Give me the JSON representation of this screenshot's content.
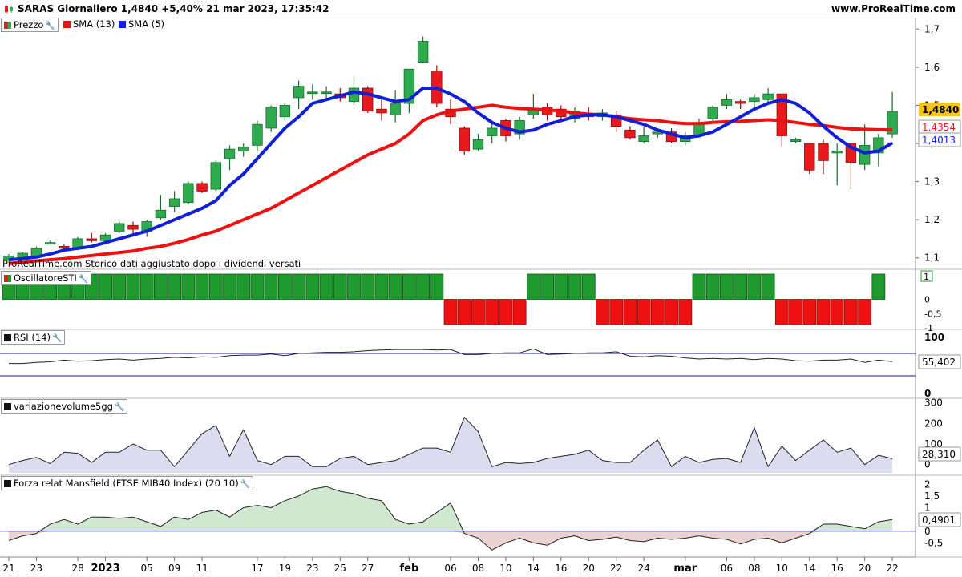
{
  "header": {
    "title": "SARAS Giornaliero 1,4840 +5,40% 21 mar 2023, 17:35:42",
    "site": "www.ProRealTime.com"
  },
  "legend_price": {
    "price": "Prezzo",
    "sma13": "SMA (13)",
    "sma5": "SMA (5)"
  },
  "note": "ProRealTime.com Storico dati aggiustato dopo i dividendi versati",
  "panel_labels": {
    "sti": "OscillatoreSTI",
    "rsi": "RSI (14)",
    "vol": "variazionevolume5gg",
    "mans": "Forza relat Mansfield (FTSE MIB40 Index) (20 10)"
  },
  "colors": {
    "up": "#2eaa4f",
    "down": "#e8191c",
    "sma13": "#ee1111",
    "sma5": "#1020d8",
    "oscGreen": "#1e9a2e",
    "oscRed": "#ee1111",
    "ref": "#1a1a8a",
    "volFill": "#dcdcf0",
    "mansUp": "#cfe8cf",
    "mansDown": "#ecd3d3"
  },
  "chart_data": [
    {
      "type": "candlestick",
      "name": "price",
      "ylim": [
        1.07,
        1.73
      ],
      "yticks": [
        "1,7",
        "1,6",
        "1,5",
        "1,4",
        "1,3",
        "1,2",
        "1,1"
      ],
      "ytick_values": [
        1.7,
        1.6,
        1.5,
        1.4,
        1.3,
        1.2,
        1.1
      ],
      "xticks": [
        "21",
        "23",
        "28",
        "2023",
        "05",
        "09",
        "11",
        "17",
        "19",
        "23",
        "25",
        "27",
        "feb",
        "06",
        "08",
        "10",
        "14",
        "16",
        "20",
        "22",
        "24",
        "mar",
        "06",
        "08",
        "10",
        "14",
        "16",
        "20",
        "22"
      ],
      "xtick_index": [
        0,
        2,
        5,
        7,
        10,
        12,
        14,
        18,
        20,
        22,
        24,
        26,
        29,
        32,
        34,
        36,
        38,
        40,
        42,
        44,
        46,
        49,
        52,
        54,
        56,
        58,
        60,
        62,
        64
      ],
      "last_labels": {
        "price": "1,4840",
        "sma13": "1,4354",
        "sma5": "1,4013"
      },
      "last_values": {
        "price": 1.484,
        "sma13": 1.4354,
        "sma5": 1.4013
      },
      "candles": [
        [
          1.095,
          1.105,
          1.11,
          1.09
        ],
        [
          1.098,
          1.112,
          1.115,
          1.095
        ],
        [
          1.105,
          1.125,
          1.13,
          1.1
        ],
        [
          1.14,
          1.14,
          1.145,
          1.135
        ],
        [
          1.13,
          1.125,
          1.135,
          1.115
        ],
        [
          1.125,
          1.15,
          1.155,
          1.12
        ],
        [
          1.15,
          1.145,
          1.165,
          1.14
        ],
        [
          1.145,
          1.16,
          1.165,
          1.14
        ],
        [
          1.17,
          1.19,
          1.195,
          1.165
        ],
        [
          1.185,
          1.175,
          1.195,
          1.16
        ],
        [
          1.17,
          1.195,
          1.2,
          1.155
        ],
        [
          1.205,
          1.225,
          1.265,
          1.2
        ],
        [
          1.235,
          1.255,
          1.275,
          1.22
        ],
        [
          1.245,
          1.295,
          1.3,
          1.24
        ],
        [
          1.295,
          1.275,
          1.3,
          1.27
        ],
        [
          1.28,
          1.35,
          1.355,
          1.275
        ],
        [
          1.36,
          1.385,
          1.395,
          1.33
        ],
        [
          1.38,
          1.39,
          1.4,
          1.365
        ],
        [
          1.395,
          1.45,
          1.46,
          1.38
        ],
        [
          1.44,
          1.495,
          1.5,
          1.43
        ],
        [
          1.47,
          1.5,
          1.505,
          1.46
        ],
        [
          1.52,
          1.55,
          1.565,
          1.49
        ],
        [
          1.535,
          1.535,
          1.555,
          1.515
        ],
        [
          1.535,
          1.535,
          1.55,
          1.515
        ],
        [
          1.53,
          1.52,
          1.545,
          1.51
        ],
        [
          1.51,
          1.545,
          1.575,
          1.5
        ],
        [
          1.545,
          1.485,
          1.55,
          1.48
        ],
        [
          1.49,
          1.48,
          1.52,
          1.46
        ],
        [
          1.475,
          1.505,
          1.54,
          1.455
        ],
        [
          1.505,
          1.595,
          1.595,
          1.48
        ],
        [
          1.613,
          1.668,
          1.68,
          1.61
        ],
        [
          1.59,
          1.505,
          1.605,
          1.495
        ],
        [
          1.49,
          1.47,
          1.515,
          1.45
        ],
        [
          1.44,
          1.38,
          1.445,
          1.37
        ],
        [
          1.385,
          1.41,
          1.425,
          1.38
        ],
        [
          1.42,
          1.44,
          1.46,
          1.4
        ],
        [
          1.46,
          1.42,
          1.465,
          1.405
        ],
        [
          1.425,
          1.46,
          1.47,
          1.41
        ],
        [
          1.475,
          1.49,
          1.53,
          1.465
        ],
        [
          1.495,
          1.475,
          1.505,
          1.46
        ],
        [
          1.49,
          1.47,
          1.5,
          1.455
        ],
        [
          1.465,
          1.485,
          1.495,
          1.455
        ],
        [
          1.475,
          1.47,
          1.495,
          1.46
        ],
        [
          1.47,
          1.48,
          1.49,
          1.46
        ],
        [
          1.475,
          1.445,
          1.485,
          1.43
        ],
        [
          1.435,
          1.415,
          1.445,
          1.41
        ],
        [
          1.405,
          1.42,
          1.445,
          1.4
        ],
        [
          1.425,
          1.43,
          1.44,
          1.415
        ],
        [
          1.43,
          1.405,
          1.44,
          1.4
        ],
        [
          1.405,
          1.42,
          1.43,
          1.395
        ],
        [
          1.42,
          1.45,
          1.465,
          1.415
        ],
        [
          1.465,
          1.495,
          1.5,
          1.46
        ],
        [
          1.5,
          1.515,
          1.53,
          1.49
        ],
        [
          1.51,
          1.505,
          1.515,
          1.49
        ],
        [
          1.51,
          1.52,
          1.53,
          1.49
        ],
        [
          1.515,
          1.53,
          1.545,
          1.505
        ],
        [
          1.53,
          1.42,
          1.53,
          1.39
        ],
        [
          1.405,
          1.41,
          1.415,
          1.4
        ],
        [
          1.4,
          1.33,
          1.4,
          1.32
        ],
        [
          1.4,
          1.355,
          1.41,
          1.32
        ],
        [
          1.375,
          1.38,
          1.4,
          1.29
        ],
        [
          1.4,
          1.35,
          1.4,
          1.28
        ],
        [
          1.345,
          1.395,
          1.45,
          1.33
        ],
        [
          1.375,
          1.415,
          1.425,
          1.34
        ],
        [
          1.425,
          1.484,
          1.535,
          1.415
        ]
      ],
      "sma13": [
        1.085,
        1.088,
        1.092,
        1.095,
        1.098,
        1.102,
        1.106,
        1.11,
        1.114,
        1.118,
        1.125,
        1.13,
        1.138,
        1.148,
        1.16,
        1.17,
        1.185,
        1.2,
        1.215,
        1.23,
        1.25,
        1.27,
        1.29,
        1.31,
        1.33,
        1.35,
        1.37,
        1.385,
        1.4,
        1.425,
        1.46,
        1.475,
        1.485,
        1.49,
        1.495,
        1.5,
        1.495,
        1.492,
        1.49,
        1.488,
        1.485,
        1.48,
        1.477,
        1.475,
        1.47,
        1.465,
        1.462,
        1.46,
        1.455,
        1.452,
        1.452,
        1.455,
        1.457,
        1.458,
        1.46,
        1.462,
        1.46,
        1.455,
        1.45,
        1.447,
        1.442,
        1.438,
        1.437,
        1.436,
        1.4354
      ],
      "sma5": [
        1.095,
        1.098,
        1.102,
        1.11,
        1.12,
        1.125,
        1.13,
        1.14,
        1.15,
        1.16,
        1.17,
        1.185,
        1.2,
        1.215,
        1.23,
        1.25,
        1.29,
        1.32,
        1.36,
        1.4,
        1.44,
        1.47,
        1.505,
        1.515,
        1.525,
        1.535,
        1.53,
        1.52,
        1.51,
        1.515,
        1.545,
        1.545,
        1.53,
        1.51,
        1.48,
        1.455,
        1.44,
        1.43,
        1.435,
        1.45,
        1.46,
        1.47,
        1.475,
        1.475,
        1.47,
        1.46,
        1.45,
        1.435,
        1.425,
        1.415,
        1.42,
        1.43,
        1.45,
        1.47,
        1.49,
        1.505,
        1.515,
        1.505,
        1.48,
        1.445,
        1.415,
        1.39,
        1.375,
        1.38,
        1.4013
      ]
    },
    {
      "type": "bar",
      "name": "OscillatoreSTI",
      "ylim": [
        -1,
        1
      ],
      "yticks": [
        "1",
        "0",
        "-0,5",
        "-1"
      ],
      "ytick_values": [
        1,
        0,
        -0.5,
        -1
      ],
      "last_label": "1",
      "values": [
        1,
        1,
        1,
        1,
        1,
        1,
        1,
        1,
        1,
        1,
        1,
        1,
        1,
        1,
        1,
        1,
        1,
        1,
        1,
        1,
        1,
        1,
        1,
        1,
        1,
        1,
        1,
        1,
        1,
        1,
        1,
        1,
        -1,
        -1,
        -1,
        -1,
        -1,
        -1,
        1,
        1,
        1,
        1,
        1,
        -1,
        -1,
        -1,
        -1,
        -1,
        -1,
        -1,
        1,
        1,
        1,
        1,
        1,
        1,
        -1,
        -1,
        -1,
        -1,
        -1,
        -1,
        -1,
        1
      ]
    },
    {
      "type": "line",
      "name": "RSI (14)",
      "ylim": [
        0,
        100
      ],
      "yticks": [
        "100",
        "0"
      ],
      "ytick_values": [
        100,
        0
      ],
      "ref_lines": [
        70,
        30
      ],
      "last_label": "55,402",
      "values": [
        52,
        52,
        54,
        55,
        58,
        56,
        57,
        59,
        60,
        58,
        60,
        61,
        63,
        62,
        64,
        63,
        66,
        67,
        67,
        69,
        66,
        70,
        71,
        72,
        72,
        73,
        75,
        76,
        77,
        77,
        77,
        76,
        77,
        68,
        68,
        70,
        71,
        71,
        78,
        68,
        69,
        70,
        71,
        71,
        73,
        65,
        64,
        66,
        65,
        62,
        60,
        61,
        60,
        61,
        59,
        61,
        60,
        57,
        56,
        58,
        58,
        60,
        54,
        58,
        55.402
      ]
    },
    {
      "type": "area",
      "name": "variazionevolume5gg",
      "ylim": [
        -40,
        310
      ],
      "yticks": [
        "300",
        "200",
        "100",
        "0"
      ],
      "ytick_values": [
        300,
        200,
        100,
        0
      ],
      "last_label": "28,310",
      "values": [
        0,
        20,
        35,
        5,
        60,
        55,
        10,
        60,
        60,
        100,
        70,
        70,
        -10,
        70,
        150,
        190,
        40,
        170,
        20,
        0,
        40,
        40,
        -10,
        -10,
        30,
        40,
        0,
        10,
        20,
        50,
        80,
        80,
        60,
        230,
        160,
        -10,
        10,
        5,
        10,
        30,
        40,
        50,
        70,
        20,
        10,
        10,
        70,
        120,
        -10,
        40,
        10,
        25,
        30,
        10,
        180,
        -10,
        90,
        20,
        70,
        120,
        60,
        80,
        0,
        45,
        28.31
      ]
    },
    {
      "type": "area",
      "name": "Forza relat Mansfield",
      "ylim": [
        -1.0,
        2.25
      ],
      "yticks": [
        "2",
        "1,5",
        "1",
        "0,5",
        "0",
        "-0,5"
      ],
      "ytick_values": [
        2,
        1.5,
        1,
        0.5,
        0,
        -0.5
      ],
      "last_label": "0,4901",
      "values": [
        -0.4,
        -0.2,
        -0.1,
        0.3,
        0.5,
        0.3,
        0.6,
        0.6,
        0.55,
        0.6,
        0.4,
        0.2,
        0.6,
        0.5,
        0.8,
        0.9,
        0.6,
        1.0,
        1.1,
        1.0,
        1.3,
        1.5,
        1.8,
        1.9,
        1.7,
        1.6,
        1.4,
        1.3,
        0.5,
        0.3,
        0.4,
        0.8,
        1.2,
        -0.1,
        -0.3,
        -0.8,
        -0.5,
        -0.3,
        -0.5,
        -0.6,
        -0.3,
        -0.2,
        -0.4,
        -0.35,
        -0.25,
        -0.4,
        -0.45,
        -0.3,
        -0.35,
        -0.3,
        -0.2,
        -0.3,
        -0.35,
        -0.55,
        -0.35,
        -0.3,
        -0.5,
        -0.3,
        -0.1,
        0.3,
        0.3,
        0.2,
        0.1,
        0.4,
        0.5
      ]
    }
  ]
}
